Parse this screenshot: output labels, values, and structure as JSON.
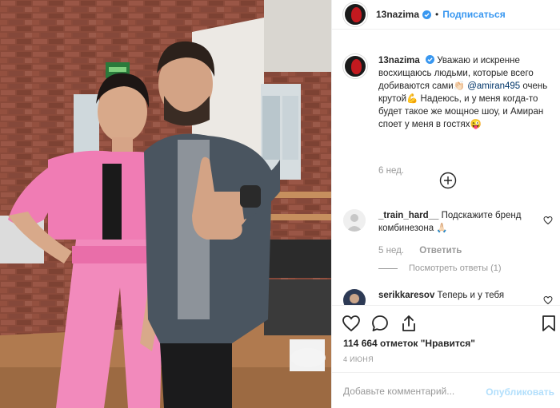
{
  "post": {
    "username": "13nazima",
    "follow_label": "Подписаться",
    "dot": "•",
    "more": "•••"
  },
  "caption": {
    "username": "13nazima",
    "text_1": "Уважаю и искренне восхищаюсь людьми, которые всего добиваются сами👏🏻",
    "mention": "@amiran495",
    "text_2": "очень крутой💪 Надеюсь, и у меня когда-то будет такое же мощное шоу, и Амиран споет у меня в гостях😜",
    "time": "6 нед."
  },
  "comments": [
    {
      "username": "_train_hard__",
      "text": "Подскажите бренд комбинезона 🙏🏻",
      "time": "5 нед.",
      "reply_label": "Ответить",
      "view_replies": "Посмотреть ответы (1)"
    },
    {
      "username": "serikkaresov",
      "text": "Теперь и у тебя"
    }
  ],
  "likes": {
    "text": "114 664 отметок \"Нравится\""
  },
  "date": "4 ИЮНЯ",
  "add_comment": {
    "placeholder": "Добавьте комментарий...",
    "publish_label": "Опубликовать"
  },
  "colors": {
    "accent": "#3897f0",
    "publish_disabled": "#b2dffc",
    "muted": "#999999",
    "text": "#262626"
  },
  "icons": [
    "verified-badge-icon",
    "more-options-icon",
    "load-more-icon",
    "heart-icon",
    "comment-icon",
    "share-icon",
    "bookmark-icon"
  ]
}
